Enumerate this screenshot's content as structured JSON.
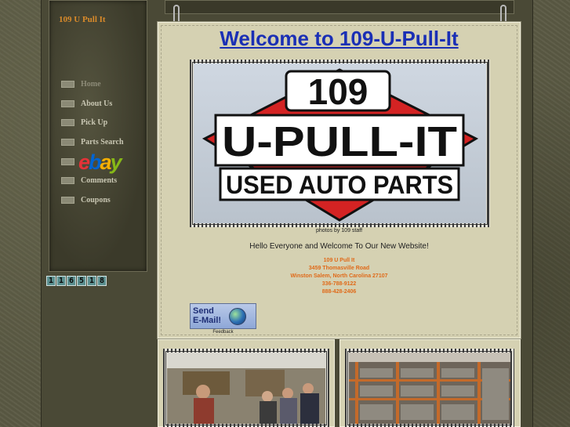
{
  "site": {
    "name": "109 U Pull It"
  },
  "nav": {
    "items": [
      {
        "label": "Home",
        "active": true
      },
      {
        "label": "About Us"
      },
      {
        "label": "Pick Up"
      },
      {
        "label": "Parts Search"
      },
      {
        "label": ""
      },
      {
        "label": "Comments"
      },
      {
        "label": "Coupons"
      }
    ],
    "ebay": {
      "letters": [
        "e",
        "b",
        "a",
        "y"
      ],
      "colors": [
        "#e53238",
        "#0064d2",
        "#f5af02",
        "#86b817"
      ]
    }
  },
  "counter": {
    "digits": [
      "1",
      "1",
      "6",
      "5",
      "1",
      "8"
    ]
  },
  "main": {
    "title": "Welcome to 109-U-Pull-It",
    "sign": {
      "line1": "109",
      "line2": "U-PULL-IT",
      "line3": "USED AUTO PARTS"
    },
    "photo_credit": "photos by 109 staff",
    "greeting": "Hello Everyone and Welcome To Our New Website!",
    "address": [
      "109 U Pull It",
      "3459 Thomasville Road",
      "Winston Salem, North Carolina 27107",
      "336-788-9122",
      "888-428-2406"
    ],
    "email_button": {
      "line1": "Send",
      "line2": "E-Mail!"
    },
    "feedback": "Feedback"
  },
  "colors": {
    "title": "#1a2fb5",
    "address": "#e06a19",
    "site_name": "#d98a2a",
    "sign_red": "#d42323"
  }
}
